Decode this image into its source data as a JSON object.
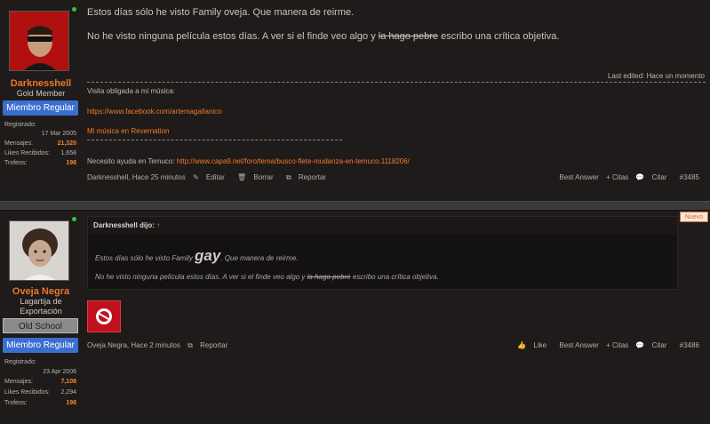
{
  "post1": {
    "user": {
      "name": "Darknesshell",
      "title": "Gold Member",
      "badge": "Miembro Regular",
      "stats": [
        {
          "label": "Registrado:",
          "value": ""
        },
        {
          "label": "",
          "value": "17 Mar 2005"
        },
        {
          "label": "Mensajes:",
          "value": "21,320"
        },
        {
          "label": "Likes Recibidos:",
          "value": "1,658"
        },
        {
          "label": "Trofeos:",
          "value": "198"
        }
      ]
    },
    "line1": "Estos días sólo he visto Family oveja. Que manera de reirme.",
    "line2_before": "No he visto ninguna película estos días. A ver si el finde veo algo y ",
    "line2_strike": "la hago pebre",
    "line2_after": " escribo una crítica objetiva.",
    "last_edited": "Last edited: Hace un momento",
    "sig_intro": "Visita obligada a mi música:",
    "sig_link1": "https://www.facebook.com/artemagallanico",
    "sig_link2": "Mi música en Revernation",
    "sig_help_label": "Necesito ayuda en Temuco: ",
    "sig_help_link": "http://www.capa9.net/foro/tema/busco-flete-mudanza-en-temuco.1118206/",
    "meta": "Darknesshell, Hace 25 minutos",
    "edit": "Editar",
    "delete": "Borrar",
    "report": "Reportar",
    "best_answer": "Best Answer",
    "citas": "+ Citas",
    "citar": "Citar",
    "number": "#3485"
  },
  "post2": {
    "user": {
      "name": "Oveja Negra",
      "title": "Lagartija de Exportación",
      "old_badge": "Old School",
      "badge": "Miembro Regular",
      "stats": [
        {
          "label": "Registrado:",
          "value": ""
        },
        {
          "label": "",
          "value": "23 Apr 2006"
        },
        {
          "label": "Mensajes:",
          "value": "7,108"
        },
        {
          "label": "Likes Recibidos:",
          "value": "2,294"
        },
        {
          "label": "Trofeos:",
          "value": "198"
        }
      ]
    },
    "new_tag": "Nuevo",
    "quote_by": "Darknesshell dijo:",
    "quote_arrow": "↑",
    "quote_l1_before": "Estos días sólo he visto Family ",
    "quote_l1_big": "gay",
    "quote_l1_after": ". Que manera de reirme.",
    "quote_l2_before": "No he visto ninguna película estos días. A ver si el finde veo algo y ",
    "quote_l2_strike": "la hago pebre",
    "quote_l2_after": " escribo una crítica objetiva.",
    "meta": "Oveja Negra, Hace 2 minutos",
    "report": "Reportar",
    "like": "Like",
    "best_answer": "Best Answer",
    "citas": "+ Citas",
    "citar": "Citar",
    "number": "#3486"
  }
}
